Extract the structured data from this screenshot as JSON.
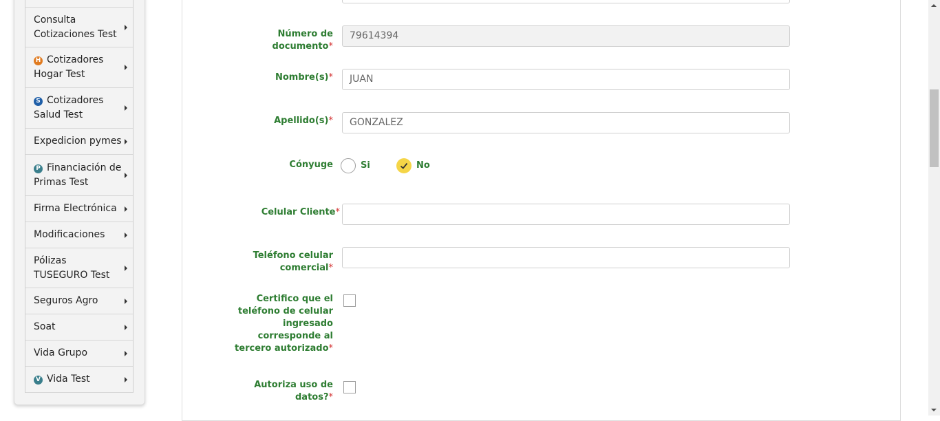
{
  "sidebar": {
    "items": [
      {
        "label": "Consulta Cotizaciones Test",
        "badge": ""
      },
      {
        "label": "Cotizadores Hogar Test",
        "badge": "H"
      },
      {
        "label": "Cotizadores Salud Test",
        "badge": "S"
      },
      {
        "label": "Expedicion pymes",
        "badge": ""
      },
      {
        "label": "Financiación de Primas Test",
        "badge": "P"
      },
      {
        "label": "Firma Electrónica",
        "badge": ""
      },
      {
        "label": "Modificaciones",
        "badge": ""
      },
      {
        "label": "Pólizas TUSEGURO Test",
        "badge": ""
      },
      {
        "label": "Seguros Agro",
        "badge": ""
      },
      {
        "label": "Soat",
        "badge": ""
      },
      {
        "label": "Vida Grupo",
        "badge": ""
      },
      {
        "label": "Vida Test",
        "badge": "V"
      }
    ]
  },
  "form": {
    "required_mark": "*",
    "documento": {
      "label_line1": "Número de",
      "label_line2": "documento",
      "value": "79614394"
    },
    "nombres": {
      "label": "Nombre(s)",
      "value": "JUAN"
    },
    "apellidos": {
      "label": "Apellido(s)",
      "value": "GONZALEZ"
    },
    "conyuge": {
      "label": "Cónyuge",
      "option_yes": "Si",
      "option_no": "No",
      "selected": "No"
    },
    "celular_cliente": {
      "label": "Celular Cliente",
      "value": ""
    },
    "telefono_comercial": {
      "label_line1": "Teléfono celular",
      "label_line2": "comercial",
      "value": ""
    },
    "certifico": {
      "lines": [
        "Certifico que el",
        "teléfono de celular",
        "ingresado",
        "corresponde al",
        "tercero autorizado"
      ],
      "checked": false
    },
    "autoriza": {
      "lines": [
        "Autoriza uso de",
        "datos?"
      ],
      "checked": false
    }
  },
  "colors": {
    "label_green": "#2e7d32",
    "required_red": "#d32f2f",
    "radio_selected": "#f5d547"
  }
}
